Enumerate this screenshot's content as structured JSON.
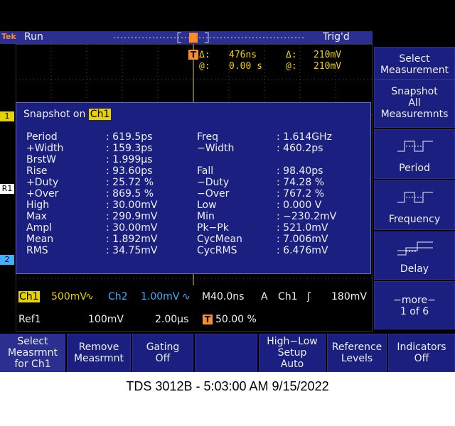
{
  "status": {
    "brand": "Tek",
    "run_state": "Run",
    "trigger_state": "Trig'd"
  },
  "cursor": {
    "t_delta_label": "Δ:",
    "t_delta_value": "476ns",
    "t_at_label": "@:",
    "t_at_value": "0.00 s",
    "v_delta_label": "Δ:",
    "v_delta_value": "210mV",
    "v_at_label": "@:",
    "v_at_value": "210mV",
    "marker": "T"
  },
  "snapshot": {
    "title": "Snapshot on",
    "channel": "Ch1",
    "rows": [
      {
        "l_name": "Period",
        "l_val": ": 619.5ps",
        "r_name": "Freq",
        "r_val": ": 1.614GHz"
      },
      {
        "l_name": "+Width",
        "l_val": ": 159.3ps",
        "r_name": "−Width",
        "r_val": ": 460.2ps"
      },
      {
        "l_name": "BrstW",
        "l_val": ": 1.999µs",
        "r_name": "",
        "r_val": ""
      },
      {
        "l_name": "Rise",
        "l_val": ": 93.60ps",
        "r_name": "Fall",
        "r_val": ": 98.40ps"
      },
      {
        "l_name": "+Duty",
        "l_val": ": 25.72 %",
        "r_name": "−Duty",
        "r_val": ": 74.28 %"
      },
      {
        "l_name": "+Over",
        "l_val": ": 869.5 %",
        "r_name": "−Over",
        "r_val": ": 767.2 %"
      },
      {
        "l_name": "High",
        "l_val": ": 30.00mV",
        "r_name": "Low",
        "r_val": ": 0.000 V"
      },
      {
        "l_name": "Max",
        "l_val": ": 290.9mV",
        "r_name": "Min",
        "r_val": ": −230.2mV"
      },
      {
        "l_name": "Ampl",
        "l_val": ": 30.00mV",
        "r_name": "Pk−Pk",
        "r_val": ": 521.0mV"
      },
      {
        "l_name": "Mean",
        "l_val": ": 1.892mV",
        "r_name": "CycMean",
        "r_val": ": 7.006mV"
      },
      {
        "l_name": "RMS",
        "l_val": ": 34.75mV",
        "r_name": "CycRMS",
        "r_val": ": 6.476mV"
      }
    ]
  },
  "markers": {
    "ch1": "1",
    "ref1": "R1",
    "ch2": "2"
  },
  "readout": {
    "ch1_label": "Ch1",
    "ch1_scale": "500mV",
    "ch1_coupling": "∿",
    "ch2_label": "Ch2",
    "ch2_scale": "1.00mV",
    "ch2_coupling": "∿",
    "timebase": "M40.0ns",
    "trig_mode": "A",
    "trig_source": "Ch1",
    "trig_slope": "ʃ",
    "trig_level": "180mV",
    "ref1_label": "Ref1",
    "ref1_scale": "100mV",
    "ref1_time": "2.00µs",
    "trig_pos_marker": "T",
    "trig_pos": "50.00 %"
  },
  "side_menu": {
    "select_measurement": "Select Measurement",
    "snapshot_all": [
      "Snapshot",
      "All",
      "Measuremnts"
    ],
    "period": "Period",
    "frequency": "Frequency",
    "delay": "Delay",
    "more": "−more−",
    "more_page": "1 of 6"
  },
  "bottom_menu": [
    [
      "Select",
      "Measrmnt",
      "for Ch1"
    ],
    [
      "Remove",
      "Measrmnt"
    ],
    [
      "Gating",
      "Off"
    ],
    [
      ""
    ],
    [
      "High−Low",
      "Setup",
      "Auto"
    ],
    [
      "Reference",
      "Levels"
    ],
    [
      "Indicators",
      "Off"
    ]
  ],
  "caption": "TDS 3012B - 5:03:00 AM   9/15/2022",
  "colors": {
    "screen": "#000000",
    "menu": "#1a1f80",
    "channel1": "#e8d200",
    "channel2": "#3fb0ff",
    "trigger": "#ff8a2a"
  }
}
